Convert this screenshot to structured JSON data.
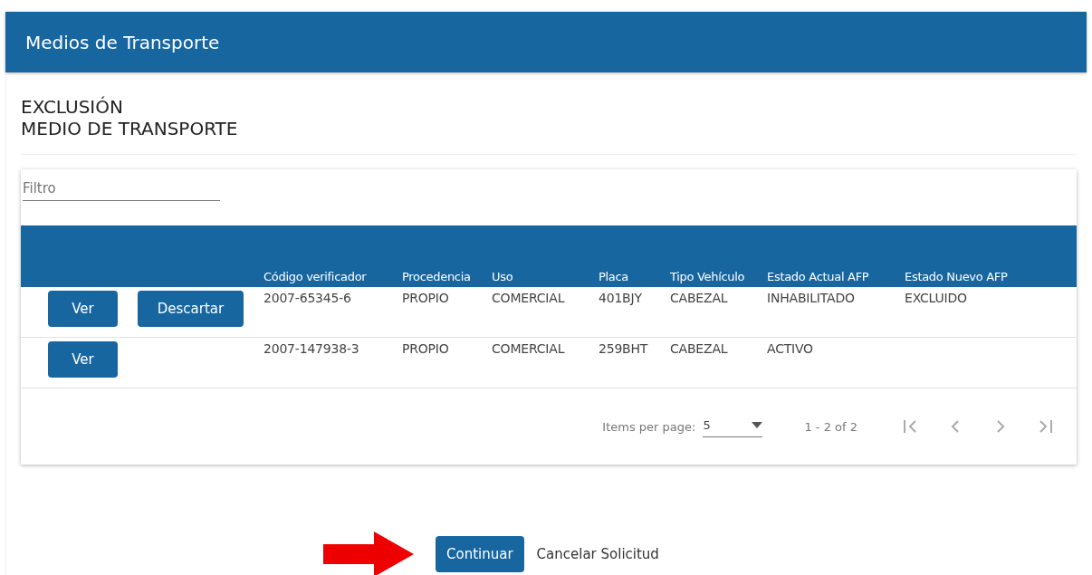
{
  "window": {
    "title": "Medios de Transporte"
  },
  "heading": {
    "line_1": "EXCLUSIÓN",
    "line_2": "MEDIO DE TRANSPORTE"
  },
  "filter": {
    "placeholder": "Filtro"
  },
  "table": {
    "columns": [
      "Código verificador",
      "Procedencia",
      "Uso",
      "Placa",
      "Tipo Vehículo",
      "Estado Actual AFP",
      "Estado Nuevo AFP"
    ],
    "rows": [
      {
        "actions": [
          {
            "kind": "view",
            "label": "Ver"
          },
          {
            "kind": "discard",
            "label": "Descartar"
          }
        ],
        "cells": [
          "2007-65345-6",
          "PROPIO",
          "COMERCIAL",
          "401BJY",
          "CABEZAL",
          "INHABILITADO",
          "EXCLUIDO"
        ]
      },
      {
        "actions": [
          {
            "kind": "view",
            "label": "Ver"
          }
        ],
        "cells": [
          "2007-147938-3",
          "PROPIO",
          "COMERCIAL",
          "259BHT",
          "CABEZAL",
          "ACTIVO",
          ""
        ]
      }
    ]
  },
  "paginator": {
    "items_per_page_label": "Items per page:",
    "page_size": "5",
    "range": "1 - 2 of 2"
  },
  "buttons": [
    {
      "kind": "primary",
      "label": "Continuar"
    },
    {
      "kind": "link",
      "label": "Cancelar Solicitud"
    }
  ]
}
